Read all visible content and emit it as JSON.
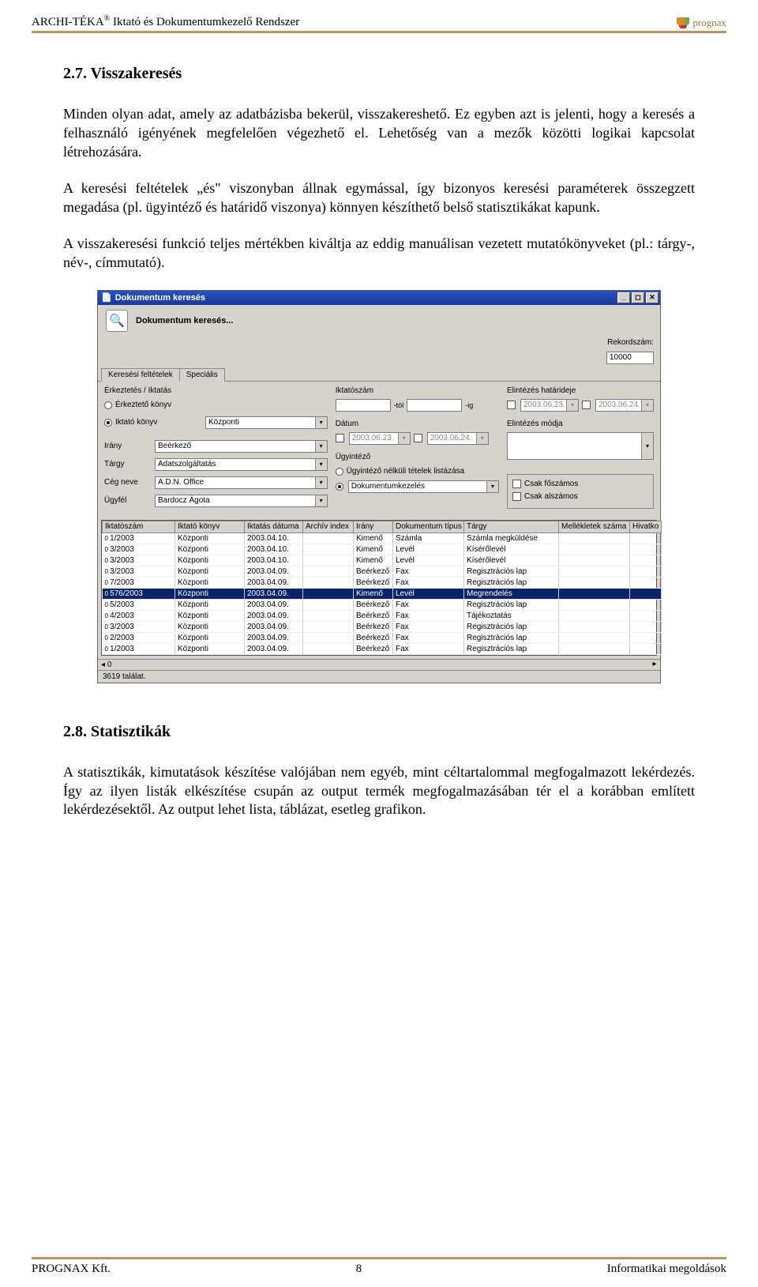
{
  "header": {
    "product": "ARCHI-TÉKA",
    "reg": "®",
    "subtitle": "Iktató és Dokumentumkezelő Rendszer",
    "brand": "prognax"
  },
  "sections": {
    "s27_title": "2.7. Visszakeresés",
    "p1": "Minden olyan adat, amely az adatbázisba bekerül, visszakereshető. Ez egyben azt is jelenti, hogy a keresés a felhasználó igényének megfelelően végezhető el. Lehetőség van a mezők közötti logikai kapcsolat létrehozására.",
    "p2": "A keresési feltételek „és\" viszonyban állnak egymással, így bizonyos keresési paraméterek összegzett megadása (pl. ügyintéző és határidő viszonya) könnyen készíthető belső statisztikákat kapunk.",
    "p3": "A visszakeresési funkció teljes mértékben kiváltja az eddig manuálisan vezetett mutatókönyveket (pl.: tárgy-, név-, címmutató).",
    "s28_title": "2.8. Statisztikák",
    "p4": "A statisztikák, kimutatások készítése valójában nem egyéb, mint céltartalommal megfogalmazott lekérdezés. Így az ilyen listák elkészítése csupán az output termék megfogalmazásában tér el a korábban említett lekérdezésektől. Az output lehet lista, táblázat, esetleg grafikon."
  },
  "window": {
    "title": "Dokumentum keresés",
    "heading": "Dokumentum keresés...",
    "rekord_label": "Rekordszám:",
    "rekord_value": "10000",
    "tabs": [
      "Keresési feltételek",
      "Speciális"
    ],
    "group_erk": "Érkeztetés / Iktatás",
    "radio_erk": "Érkeztető könyv",
    "radio_ikt": "Iktató könyv",
    "iktatokonyv_value": "Központi",
    "irany_lbl": "Irány",
    "irany_val": "Beérkező",
    "targy_lbl": "Tárgy",
    "targy_val": "Adatszolgáltatás",
    "ceg_lbl": "Cég neve",
    "ceg_val": "A.D.N. Office",
    "ugyfel_lbl": "Ügyfél",
    "ugyfel_val": "Bardocz Ágota",
    "iktatoszam_lbl": "Iktatószám",
    "tol": "-tól",
    "ig": "-ig",
    "datum_lbl": "Dátum",
    "d1": "2003.06.23.",
    "d2": "2003.06.24.",
    "ugyintezo_lbl": "Ügyintéző",
    "ugy_nelkul": "Ügyintéző nélküli tételek listázása",
    "ugy_val": "Dokumentumkezelés",
    "eh_lbl": "Elintézés határideje",
    "eh1": "2003.06.23.",
    "eh2": "2003.06.24.",
    "em_lbl": "Elintézés módja",
    "cfos": "Csak főszámos",
    "cals": "Csak alszámos",
    "columns": [
      "Iktatószám",
      "Iktató könyv",
      "Iktatás dátuma",
      "Archív index",
      "Irány",
      "Dokumentum típus",
      "Tárgy",
      "Mellékletek száma",
      "Hivatko"
    ],
    "rows": [
      {
        "c": [
          "1/2003",
          "Központi",
          "2003.04.10.",
          "",
          "Kimenő",
          "Számla",
          "Számla megküldése",
          "",
          ""
        ]
      },
      {
        "c": [
          "3/2003",
          "Központi",
          "2003.04.10.",
          "",
          "Kimenő",
          "Levél",
          "Kísérőlevél",
          "",
          ""
        ]
      },
      {
        "c": [
          "3/2003",
          "Központi",
          "2003.04.10.",
          "",
          "Kimenő",
          "Levél",
          "Kísérőlevél",
          "",
          ""
        ]
      },
      {
        "c": [
          "3/2003",
          "Központi",
          "2003.04.09.",
          "",
          "Beérkező",
          "Fax",
          "Regisztrációs lap",
          "",
          ""
        ]
      },
      {
        "c": [
          "7/2003",
          "Központi",
          "2003.04.09.",
          "",
          "Beérkező",
          "Fax",
          "Regisztrációs lap",
          "",
          ""
        ]
      },
      {
        "c": [
          "576/2003",
          "Központi",
          "2003.04.09.",
          "",
          "Kimenő",
          "Levél",
          "Megrendelés",
          "",
          ""
        ],
        "sel": true
      },
      {
        "c": [
          "5/2003",
          "Központi",
          "2003.04.09.",
          "",
          "Beérkező",
          "Fax",
          "Regisztrációs lap",
          "",
          ""
        ]
      },
      {
        "c": [
          "4/2003",
          "Központi",
          "2003.04.09.",
          "",
          "Beérkező",
          "Fax",
          "Tájékoztatás",
          "",
          ""
        ]
      },
      {
        "c": [
          "3/2003",
          "Központi",
          "2003.04.09.",
          "",
          "Beérkező",
          "Fax",
          "Regisztrációs lap",
          "",
          ""
        ]
      },
      {
        "c": [
          "2/2003",
          "Központi",
          "2003.04.09.",
          "",
          "Beérkező",
          "Fax",
          "Regisztrációs lap",
          "",
          ""
        ]
      },
      {
        "c": [
          "1/2003",
          "Központi",
          "2003.04.09.",
          "",
          "Beérkező",
          "Fax",
          "Regisztrációs lap",
          "",
          ""
        ]
      }
    ],
    "status": "3619 találat.",
    "row_marker": "0"
  },
  "footer": {
    "left": "PROGNAX Kft.",
    "page": "8",
    "right": "Informatikai megoldások"
  }
}
